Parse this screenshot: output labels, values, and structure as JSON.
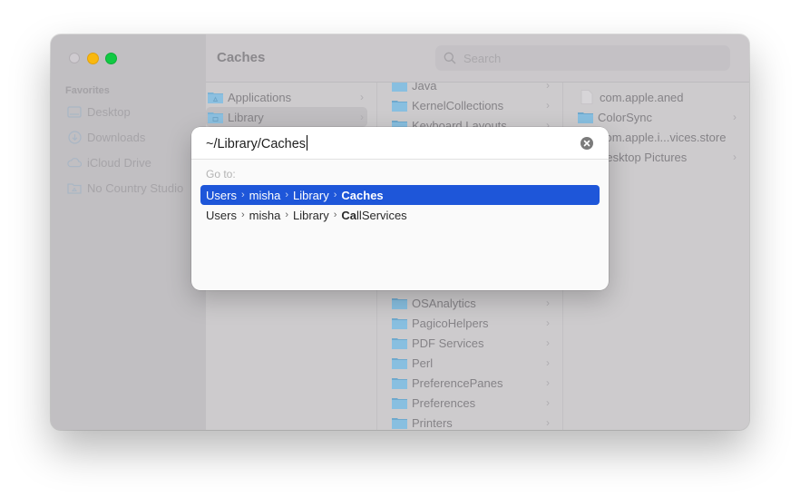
{
  "window": {
    "title": "Caches",
    "search_placeholder": "Search"
  },
  "sidebar": {
    "section_title": "Favorites",
    "items": [
      {
        "label": "Desktop",
        "icon": "desktop-icon"
      },
      {
        "label": "Downloads",
        "icon": "downloads-icon"
      },
      {
        "label": "iCloud Drive",
        "icon": "cloud-icon"
      },
      {
        "label": "No Country Studio",
        "icon": "folder-icon"
      }
    ]
  },
  "columns": {
    "col1": [
      {
        "label": "Applications",
        "selected": false
      },
      {
        "label": "Library",
        "selected": true
      }
    ],
    "col2_top": [
      {
        "label": "Java"
      },
      {
        "label": "KernelCollections"
      },
      {
        "label": "Keyboard Layouts"
      }
    ],
    "col2_bottom": [
      {
        "label": "OSAnalytics"
      },
      {
        "label": "PagicoHelpers"
      },
      {
        "label": "PDF Services"
      },
      {
        "label": "Perl"
      },
      {
        "label": "PreferencePanes"
      },
      {
        "label": "Preferences"
      },
      {
        "label": "Printers"
      }
    ],
    "col3": [
      {
        "label": "com.apple.aned",
        "type": "file"
      },
      {
        "label": "ColorSync",
        "type": "folder"
      },
      {
        "label": "com.apple.i...vices.store",
        "type": "file"
      },
      {
        "label": "Desktop Pictures",
        "type": "folder"
      }
    ]
  },
  "goto_dialog": {
    "input_value": "~/Library/Caches",
    "goto_label": "Go to:",
    "suggestions": [
      {
        "parts": [
          "Users",
          "misha",
          "Library"
        ],
        "match_bold": "Caches",
        "match_rest": "",
        "active": true
      },
      {
        "parts": [
          "Users",
          "misha",
          "Library"
        ],
        "match_bold": "Ca",
        "match_rest_prefix": "ll",
        "match_bold2": "Servi",
        "match_rest": "ces",
        "active": false
      }
    ],
    "separator": "›"
  },
  "colors": {
    "accent": "#1e56d9",
    "close": "#cfcbd0",
    "minimize": "#f9b80f",
    "maximize": "#11c943",
    "folder": "#7cb4d6"
  }
}
